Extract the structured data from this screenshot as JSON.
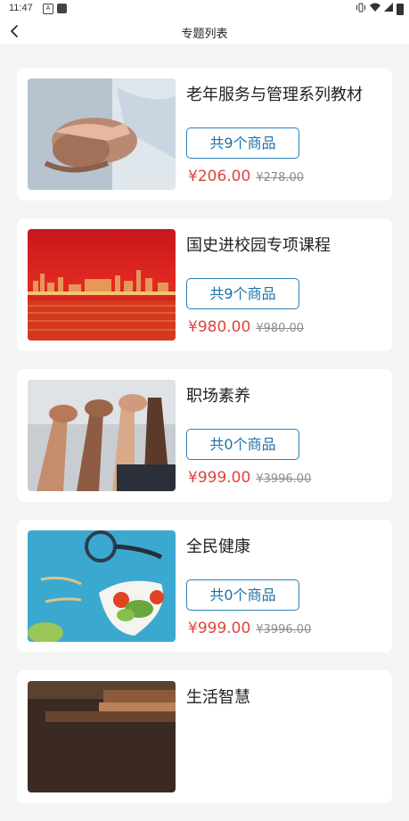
{
  "status": {
    "time": "11:47",
    "notification_letter": "A"
  },
  "header": {
    "title": "专题列表"
  },
  "topics": [
    {
      "title": "老年服务与管理系列教材",
      "count_label": "共9个商品",
      "price": "¥206.00",
      "original_price": "¥278.00"
    },
    {
      "title": "国史进校园专项课程",
      "count_label": "共9个商品",
      "price": "¥980.00",
      "original_price": "¥980.00"
    },
    {
      "title": "职场素养",
      "count_label": "共0个商品",
      "price": "¥999.00",
      "original_price": "¥3996.00"
    },
    {
      "title": "全民健康",
      "count_label": "共0个商品",
      "price": "¥999.00",
      "original_price": "¥3996.00"
    },
    {
      "title": "生活智慧"
    }
  ],
  "colors": {
    "price": "#e0443d",
    "button_border": "#2b7fb8",
    "background": "#f4f4f4"
  }
}
